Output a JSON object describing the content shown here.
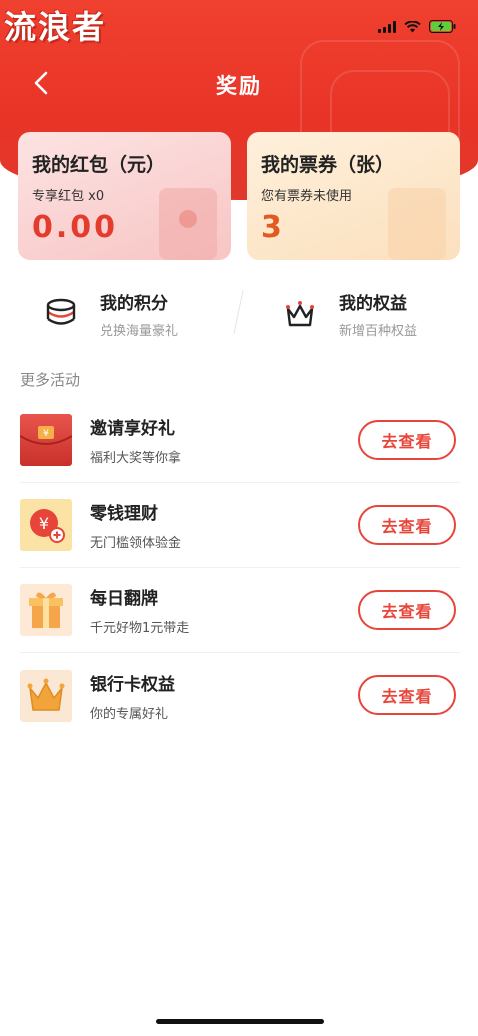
{
  "watermark": "流浪者",
  "status": {
    "battery_color": "#5ccf3a"
  },
  "header": {
    "title": "奖励",
    "back_icon": "chevron-left-icon"
  },
  "cards": [
    {
      "title": "我的红包（元）",
      "subtitle": "专享红包 x0",
      "value": "0.00"
    },
    {
      "title": "我的票券（张）",
      "subtitle": "您有票券未使用",
      "value": "3"
    }
  ],
  "features": [
    {
      "title": "我的积分",
      "subtitle": "兑换海量豪礼",
      "icon": "coins-stack-icon"
    },
    {
      "title": "我的权益",
      "subtitle": "新增百种权益",
      "icon": "crown-icon"
    }
  ],
  "section_title": "更多活动",
  "activities": [
    {
      "title": "邀请享好礼",
      "subtitle": "福利大奖等你拿",
      "button": "去查看",
      "icon": "red-envelope-icon"
    },
    {
      "title": "零钱理财",
      "subtitle": "无门槛领体验金",
      "button": "去查看",
      "icon": "yuan-coin-icon"
    },
    {
      "title": "每日翻牌",
      "subtitle": "千元好物1元带走",
      "button": "去查看",
      "icon": "gift-box-icon"
    },
    {
      "title": "银行卡权益",
      "subtitle": "你的专属好礼",
      "button": "去查看",
      "icon": "gold-crown-icon"
    }
  ],
  "colors": {
    "brand_red": "#e8453a",
    "header_red": "#f0402f"
  }
}
